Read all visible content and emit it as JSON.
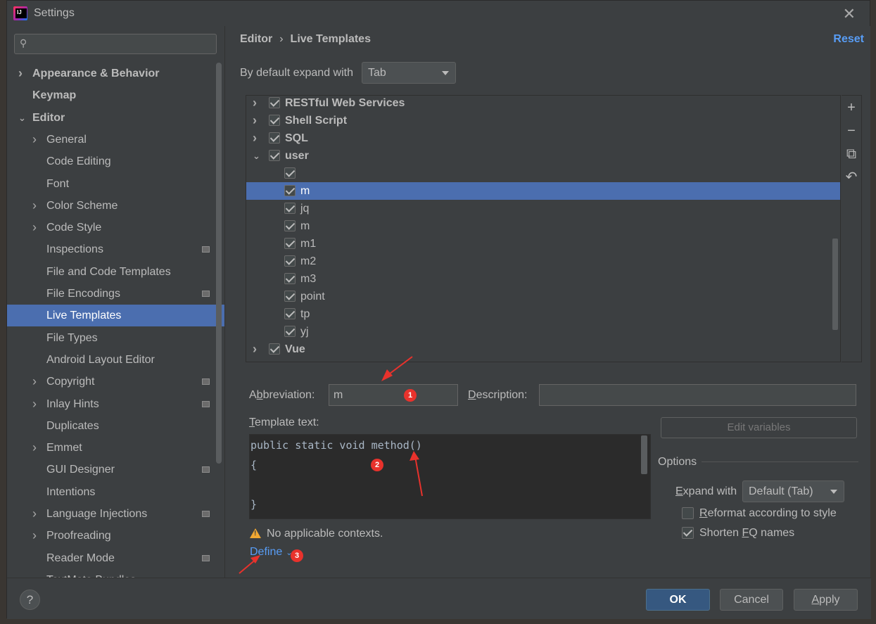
{
  "window": {
    "title": "Settings",
    "close_glyph": "✕",
    "logo": "intellij-idea-logo"
  },
  "sidebar": {
    "search_placeholder": "",
    "search_icon": "🔍",
    "items": [
      {
        "label": "Appearance & Behavior",
        "level": 0,
        "expandable": true,
        "expanded": false,
        "bold": true
      },
      {
        "label": "Keymap",
        "level": 0,
        "expandable": false,
        "bold": true
      },
      {
        "label": "Editor",
        "level": 0,
        "expandable": true,
        "expanded": true,
        "bold": true
      },
      {
        "label": "General",
        "level": 1,
        "expandable": true
      },
      {
        "label": "Code Editing",
        "level": 1
      },
      {
        "label": "Font",
        "level": 1
      },
      {
        "label": "Color Scheme",
        "level": 1,
        "expandable": true
      },
      {
        "label": "Code Style",
        "level": 1,
        "expandable": true
      },
      {
        "label": "Inspections",
        "level": 1,
        "project": true
      },
      {
        "label": "File and Code Templates",
        "level": 1
      },
      {
        "label": "File Encodings",
        "level": 1,
        "project": true
      },
      {
        "label": "Live Templates",
        "level": 1,
        "selected": true
      },
      {
        "label": "File Types",
        "level": 1
      },
      {
        "label": "Android Layout Editor",
        "level": 1
      },
      {
        "label": "Copyright",
        "level": 1,
        "expandable": true,
        "project": true
      },
      {
        "label": "Inlay Hints",
        "level": 1,
        "expandable": true,
        "project": true
      },
      {
        "label": "Duplicates",
        "level": 1
      },
      {
        "label": "Emmet",
        "level": 1,
        "expandable": true
      },
      {
        "label": "GUI Designer",
        "level": 1,
        "project": true
      },
      {
        "label": "Intentions",
        "level": 1
      },
      {
        "label": "Language Injections",
        "level": 1,
        "expandable": true,
        "project": true
      },
      {
        "label": "Proofreading",
        "level": 1,
        "expandable": true
      },
      {
        "label": "Reader Mode",
        "level": 1,
        "project": true
      },
      {
        "label": "TextMate Bundles",
        "level": 1
      }
    ]
  },
  "header": {
    "breadcrumb": [
      "Editor",
      "Live Templates"
    ],
    "breadcrumb_sep": "›",
    "reset_label": "Reset"
  },
  "expand": {
    "label": "By default expand with",
    "value": "Tab"
  },
  "templates": {
    "rows": [
      {
        "label": "RESTful Web Services",
        "group": true,
        "expanded": false,
        "checked": true
      },
      {
        "label": "Shell Script",
        "group": true,
        "expanded": false,
        "checked": true
      },
      {
        "label": "SQL",
        "group": true,
        "expanded": false,
        "checked": true
      },
      {
        "label": "user",
        "group": true,
        "expanded": true,
        "checked": true
      },
      {
        "label": "",
        "group": false,
        "checked": true
      },
      {
        "label": "m",
        "group": false,
        "checked": true,
        "selected": true
      },
      {
        "label": "jq",
        "group": false,
        "checked": true
      },
      {
        "label": "m",
        "group": false,
        "checked": true
      },
      {
        "label": "m1",
        "group": false,
        "checked": true
      },
      {
        "label": "m2",
        "group": false,
        "checked": true
      },
      {
        "label": "m3",
        "group": false,
        "checked": true
      },
      {
        "label": "point",
        "group": false,
        "checked": true
      },
      {
        "label": "tp",
        "group": false,
        "checked": true
      },
      {
        "label": "yj",
        "group": false,
        "checked": true
      },
      {
        "label": "Vue",
        "group": true,
        "expanded": false,
        "checked": true
      }
    ],
    "actions": [
      {
        "name": "add-icon",
        "glyph": "+"
      },
      {
        "name": "remove-icon",
        "glyph": "−"
      },
      {
        "name": "copy-icon",
        "glyph": "⧉"
      },
      {
        "name": "restore-icon",
        "glyph": "↶"
      }
    ]
  },
  "editor": {
    "abbreviation_label_pre": "A",
    "abbreviation_label_u": "b",
    "abbreviation_label_post": "breviation:",
    "abbreviation_value": "m",
    "description_label_u": "D",
    "description_label_post": "escription:",
    "description_value": "",
    "template_text_label_u": "T",
    "template_text_label_post": "emplate text:",
    "template_lines": [
      "public static void method()",
      "{",
      "",
      "}"
    ],
    "edit_variables_label": "Edit variables"
  },
  "options": {
    "title": "Options",
    "expand_with_label_u": "E",
    "expand_with_label_post": "xpand with",
    "expand_with_value": "Default (Tab)",
    "reformat_label_u": "R",
    "reformat_label_post": "eformat according to style",
    "reformat_checked": false,
    "shorten_label_pre": "Shorten ",
    "shorten_label_u": "F",
    "shorten_label_post": "Q names",
    "shorten_checked": true
  },
  "contexts": {
    "warning_text": "No applicable contexts.",
    "define_label": "Define",
    "define_chevron": "⌄"
  },
  "annotations": {
    "badges": [
      "1",
      "2",
      "3"
    ],
    "color": "#e8322c"
  },
  "footer": {
    "help_label": "?",
    "ok_label": "OK",
    "cancel_label": "Cancel",
    "apply_label_u": "A",
    "apply_label_post": "pply"
  },
  "colors": {
    "accent": "#4b6eaf",
    "link": "#589df6",
    "warning": "#f0a732",
    "background": "#3c3f41"
  }
}
